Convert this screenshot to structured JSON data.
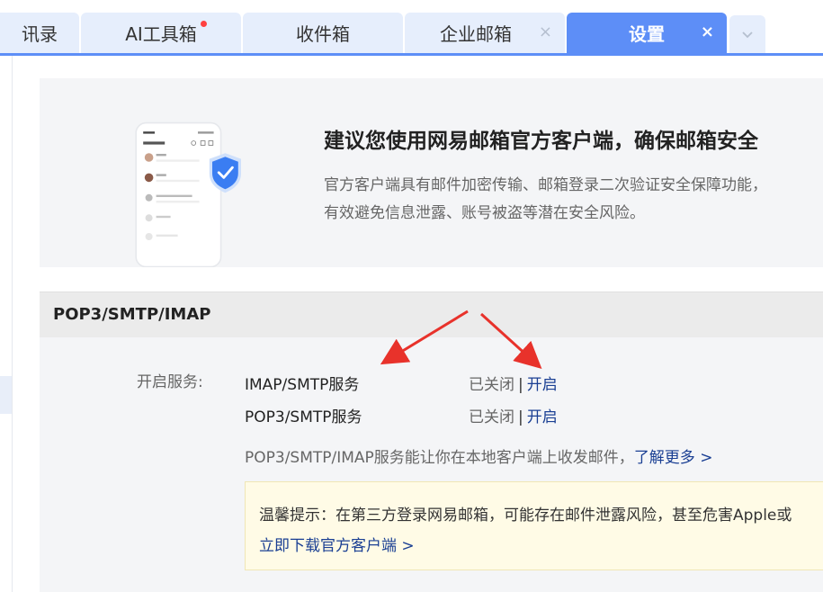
{
  "tabs": [
    {
      "label": "讯录",
      "active": false
    },
    {
      "label": "AI工具箱",
      "active": false,
      "badge": true
    },
    {
      "label": "收件箱",
      "active": false
    },
    {
      "label": "企业邮箱",
      "active": false,
      "close": "×"
    },
    {
      "label": "设置",
      "active": true,
      "close": "×"
    }
  ],
  "banner": {
    "title": "建议您使用网易邮箱官方客户端，确保邮箱安全",
    "description": "官方客户端具有邮件加密传输、邮箱登录二次验证安全保障功能，有效避免信息泄露、账号被盗等潜在安全风险。"
  },
  "section": {
    "title": "POP3/SMTP/IMAP",
    "service_label": "开启服务:",
    "services": [
      {
        "name": "IMAP/SMTP服务",
        "status": "已关闭",
        "separator": "|",
        "action": "开启"
      },
      {
        "name": "POP3/SMTP服务",
        "status": "已关闭",
        "separator": "|",
        "action": "开启"
      }
    ],
    "note": "POP3/SMTP/IMAP服务能让你在本地客户端上收发邮件，",
    "learn_more": "了解更多 >"
  },
  "tip": {
    "text": "温馨提示：在第三方登录网易邮箱，可能存在邮件泄露风险，甚至危害Apple或",
    "link": "立即下载官方客户端 >"
  },
  "colors": {
    "accent": "#5d8ef7",
    "link": "#1a3f93",
    "arrow": "#e8322b"
  }
}
